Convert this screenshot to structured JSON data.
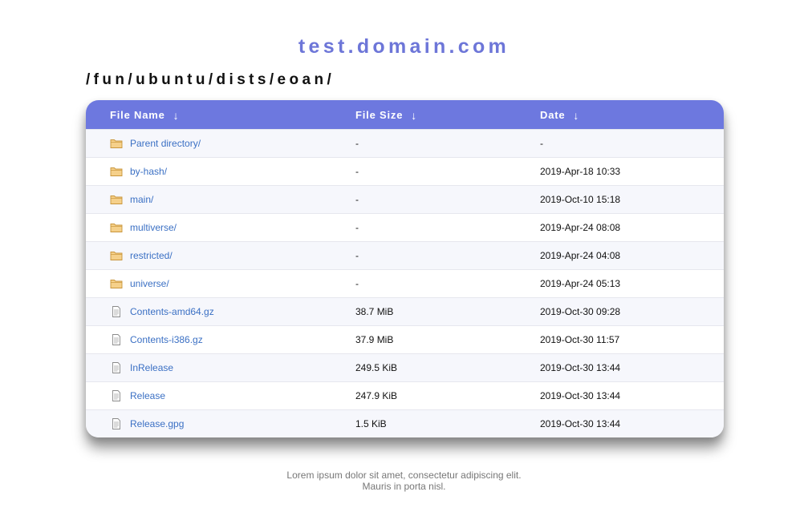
{
  "site": {
    "title": "test.domain.com",
    "path": "/fun/ubuntu/dists/eoan/"
  },
  "table": {
    "headers": {
      "name": "File Name",
      "size": "File Size",
      "date": "Date",
      "sort_glyph": "↓"
    },
    "rows": [
      {
        "icon": "folder-icon",
        "name": "Parent directory/",
        "size": "-",
        "date": "-"
      },
      {
        "icon": "folder-icon",
        "name": "by-hash/",
        "size": "-",
        "date": "2019-Apr-18 10:33"
      },
      {
        "icon": "folder-icon",
        "name": "main/",
        "size": "-",
        "date": "2019-Oct-10 15:18"
      },
      {
        "icon": "folder-icon",
        "name": "multiverse/",
        "size": "-",
        "date": "2019-Apr-24 08:08"
      },
      {
        "icon": "folder-icon",
        "name": "restricted/",
        "size": "-",
        "date": "2019-Apr-24 04:08"
      },
      {
        "icon": "folder-icon",
        "name": "universe/",
        "size": "-",
        "date": "2019-Apr-24 05:13"
      },
      {
        "icon": "file-icon",
        "name": "Contents-amd64.gz",
        "size": "38.7 MiB",
        "date": "2019-Oct-30 09:28"
      },
      {
        "icon": "file-icon",
        "name": "Contents-i386.gz",
        "size": "37.9 MiB",
        "date": "2019-Oct-30 11:57"
      },
      {
        "icon": "file-icon",
        "name": "InRelease",
        "size": "249.5 KiB",
        "date": "2019-Oct-30 13:44"
      },
      {
        "icon": "file-icon",
        "name": "Release",
        "size": "247.9 KiB",
        "date": "2019-Oct-30 13:44"
      },
      {
        "icon": "file-icon",
        "name": "Release.gpg",
        "size": "1.5 KiB",
        "date": "2019-Oct-30 13:44"
      }
    ]
  },
  "footer": {
    "line1": "Lorem ipsum dolor sit amet, consectetur adipiscing elit.",
    "line2": "Mauris in porta nisl."
  },
  "colors": {
    "accent": "#6d76d8",
    "header_bg": "#6d78df",
    "link": "#3b70c4",
    "folder": "#f3c97a"
  }
}
